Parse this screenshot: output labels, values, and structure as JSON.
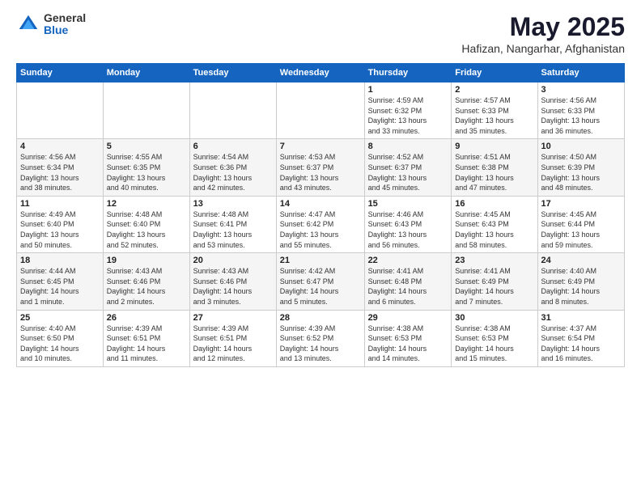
{
  "logo": {
    "general": "General",
    "blue": "Blue"
  },
  "title": "May 2025",
  "subtitle": "Hafizan, Nangarhar, Afghanistan",
  "days_header": [
    "Sunday",
    "Monday",
    "Tuesday",
    "Wednesday",
    "Thursday",
    "Friday",
    "Saturday"
  ],
  "weeks": [
    [
      {
        "day": "",
        "info": ""
      },
      {
        "day": "",
        "info": ""
      },
      {
        "day": "",
        "info": ""
      },
      {
        "day": "",
        "info": ""
      },
      {
        "day": "1",
        "info": "Sunrise: 4:59 AM\nSunset: 6:32 PM\nDaylight: 13 hours\nand 33 minutes."
      },
      {
        "day": "2",
        "info": "Sunrise: 4:57 AM\nSunset: 6:33 PM\nDaylight: 13 hours\nand 35 minutes."
      },
      {
        "day": "3",
        "info": "Sunrise: 4:56 AM\nSunset: 6:33 PM\nDaylight: 13 hours\nand 36 minutes."
      }
    ],
    [
      {
        "day": "4",
        "info": "Sunrise: 4:56 AM\nSunset: 6:34 PM\nDaylight: 13 hours\nand 38 minutes."
      },
      {
        "day": "5",
        "info": "Sunrise: 4:55 AM\nSunset: 6:35 PM\nDaylight: 13 hours\nand 40 minutes."
      },
      {
        "day": "6",
        "info": "Sunrise: 4:54 AM\nSunset: 6:36 PM\nDaylight: 13 hours\nand 42 minutes."
      },
      {
        "day": "7",
        "info": "Sunrise: 4:53 AM\nSunset: 6:37 PM\nDaylight: 13 hours\nand 43 minutes."
      },
      {
        "day": "8",
        "info": "Sunrise: 4:52 AM\nSunset: 6:37 PM\nDaylight: 13 hours\nand 45 minutes."
      },
      {
        "day": "9",
        "info": "Sunrise: 4:51 AM\nSunset: 6:38 PM\nDaylight: 13 hours\nand 47 minutes."
      },
      {
        "day": "10",
        "info": "Sunrise: 4:50 AM\nSunset: 6:39 PM\nDaylight: 13 hours\nand 48 minutes."
      }
    ],
    [
      {
        "day": "11",
        "info": "Sunrise: 4:49 AM\nSunset: 6:40 PM\nDaylight: 13 hours\nand 50 minutes."
      },
      {
        "day": "12",
        "info": "Sunrise: 4:48 AM\nSunset: 6:40 PM\nDaylight: 13 hours\nand 52 minutes."
      },
      {
        "day": "13",
        "info": "Sunrise: 4:48 AM\nSunset: 6:41 PM\nDaylight: 13 hours\nand 53 minutes."
      },
      {
        "day": "14",
        "info": "Sunrise: 4:47 AM\nSunset: 6:42 PM\nDaylight: 13 hours\nand 55 minutes."
      },
      {
        "day": "15",
        "info": "Sunrise: 4:46 AM\nSunset: 6:43 PM\nDaylight: 13 hours\nand 56 minutes."
      },
      {
        "day": "16",
        "info": "Sunrise: 4:45 AM\nSunset: 6:43 PM\nDaylight: 13 hours\nand 58 minutes."
      },
      {
        "day": "17",
        "info": "Sunrise: 4:45 AM\nSunset: 6:44 PM\nDaylight: 13 hours\nand 59 minutes."
      }
    ],
    [
      {
        "day": "18",
        "info": "Sunrise: 4:44 AM\nSunset: 6:45 PM\nDaylight: 14 hours\nand 1 minute."
      },
      {
        "day": "19",
        "info": "Sunrise: 4:43 AM\nSunset: 6:46 PM\nDaylight: 14 hours\nand 2 minutes."
      },
      {
        "day": "20",
        "info": "Sunrise: 4:43 AM\nSunset: 6:46 PM\nDaylight: 14 hours\nand 3 minutes."
      },
      {
        "day": "21",
        "info": "Sunrise: 4:42 AM\nSunset: 6:47 PM\nDaylight: 14 hours\nand 5 minutes."
      },
      {
        "day": "22",
        "info": "Sunrise: 4:41 AM\nSunset: 6:48 PM\nDaylight: 14 hours\nand 6 minutes."
      },
      {
        "day": "23",
        "info": "Sunrise: 4:41 AM\nSunset: 6:49 PM\nDaylight: 14 hours\nand 7 minutes."
      },
      {
        "day": "24",
        "info": "Sunrise: 4:40 AM\nSunset: 6:49 PM\nDaylight: 14 hours\nand 8 minutes."
      }
    ],
    [
      {
        "day": "25",
        "info": "Sunrise: 4:40 AM\nSunset: 6:50 PM\nDaylight: 14 hours\nand 10 minutes."
      },
      {
        "day": "26",
        "info": "Sunrise: 4:39 AM\nSunset: 6:51 PM\nDaylight: 14 hours\nand 11 minutes."
      },
      {
        "day": "27",
        "info": "Sunrise: 4:39 AM\nSunset: 6:51 PM\nDaylight: 14 hours\nand 12 minutes."
      },
      {
        "day": "28",
        "info": "Sunrise: 4:39 AM\nSunset: 6:52 PM\nDaylight: 14 hours\nand 13 minutes."
      },
      {
        "day": "29",
        "info": "Sunrise: 4:38 AM\nSunset: 6:53 PM\nDaylight: 14 hours\nand 14 minutes."
      },
      {
        "day": "30",
        "info": "Sunrise: 4:38 AM\nSunset: 6:53 PM\nDaylight: 14 hours\nand 15 minutes."
      },
      {
        "day": "31",
        "info": "Sunrise: 4:37 AM\nSunset: 6:54 PM\nDaylight: 14 hours\nand 16 minutes."
      }
    ]
  ]
}
